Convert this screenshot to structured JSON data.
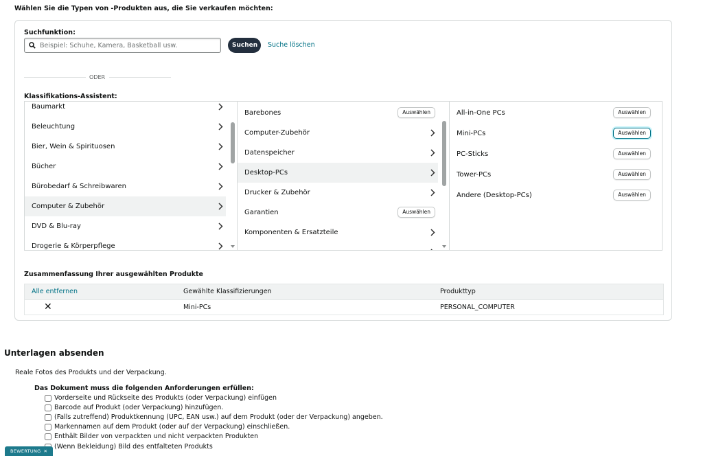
{
  "page": {
    "instruction": "Wählen Sie die Typen von -Produkten aus, die Sie verkaufen möchten:"
  },
  "search": {
    "label": "Suchfunktion:",
    "placeholder": "Beispiel: Schuhe, Kamera, Basketball usw.",
    "value": "",
    "button_label": "Suchen",
    "clear_label": "Suche löschen",
    "or_label": "ODER"
  },
  "classification": {
    "label": "Klassifikations-Assistent:",
    "select_label": "Auswählen",
    "column1": [
      {
        "label": "Baumarkt"
      },
      {
        "label": "Beleuchtung"
      },
      {
        "label": "Bier, Wein & Spirituosen"
      },
      {
        "label": "Bücher"
      },
      {
        "label": "Bürobedarf & Schreibwaren"
      },
      {
        "label": "Computer & Zubehör"
      },
      {
        "label": "DVD & Blu-ray"
      },
      {
        "label": "Drogerie & Körperpflege"
      }
    ],
    "column2": [
      {
        "label": "Barebones"
      },
      {
        "label": "Computer-Zubehör"
      },
      {
        "label": "Datenspeicher"
      },
      {
        "label": "Desktop-PCs"
      },
      {
        "label": "Drucker & Zubehör"
      },
      {
        "label": "Garantien"
      },
      {
        "label": "Komponenten & Ersatzteile"
      }
    ],
    "column3": [
      {
        "label": "All-in-One PCs"
      },
      {
        "label": "Mini-PCs"
      },
      {
        "label": "PC-Sticks"
      },
      {
        "label": "Tower-PCs"
      },
      {
        "label": "Andere (Desktop-PCs)"
      }
    ]
  },
  "summary": {
    "title": "Zusammenfassung Ihrer ausgewählten Produkte",
    "remove_all": "Alle entfernen",
    "col_classification": "Gewählte Klassifizierungen",
    "col_type": "Produkttyp",
    "rows": [
      {
        "remove": "✕",
        "classification": "Mini-PCs",
        "type": "PERSONAL_COMPUTER"
      }
    ]
  },
  "documents": {
    "title": "Unterlagen absenden",
    "description": "Reale Fotos des Produkts und der Verpackung.",
    "requirements_title": "Das Dokument muss die folgenden Anforderungen erfüllen:",
    "requirements": [
      "Vorderseite und Rückseite des Produkts (oder Verpackung) einfügen",
      "Barcode auf Produkt (oder Verpackung) hinzufügen.",
      "(Falls zutreffend) Produktkennung (UPC, EAN usw.) auf dem Produkt (oder der Verpackung) angeben.",
      "Markennamen auf dem Produkt (oder auf der Verpackung) einschließen.",
      "Enthält Bilder von verpackten und nicht verpackten Produkten",
      "(Wenn Bekleidung) Bild des entfalteten Produkts"
    ]
  },
  "feedback": {
    "label": "BEWERTUNG",
    "close": "✕"
  },
  "colors": {
    "accent": "#007185",
    "button_dark": "#232f3e",
    "active_row": "#f0f2f2"
  }
}
